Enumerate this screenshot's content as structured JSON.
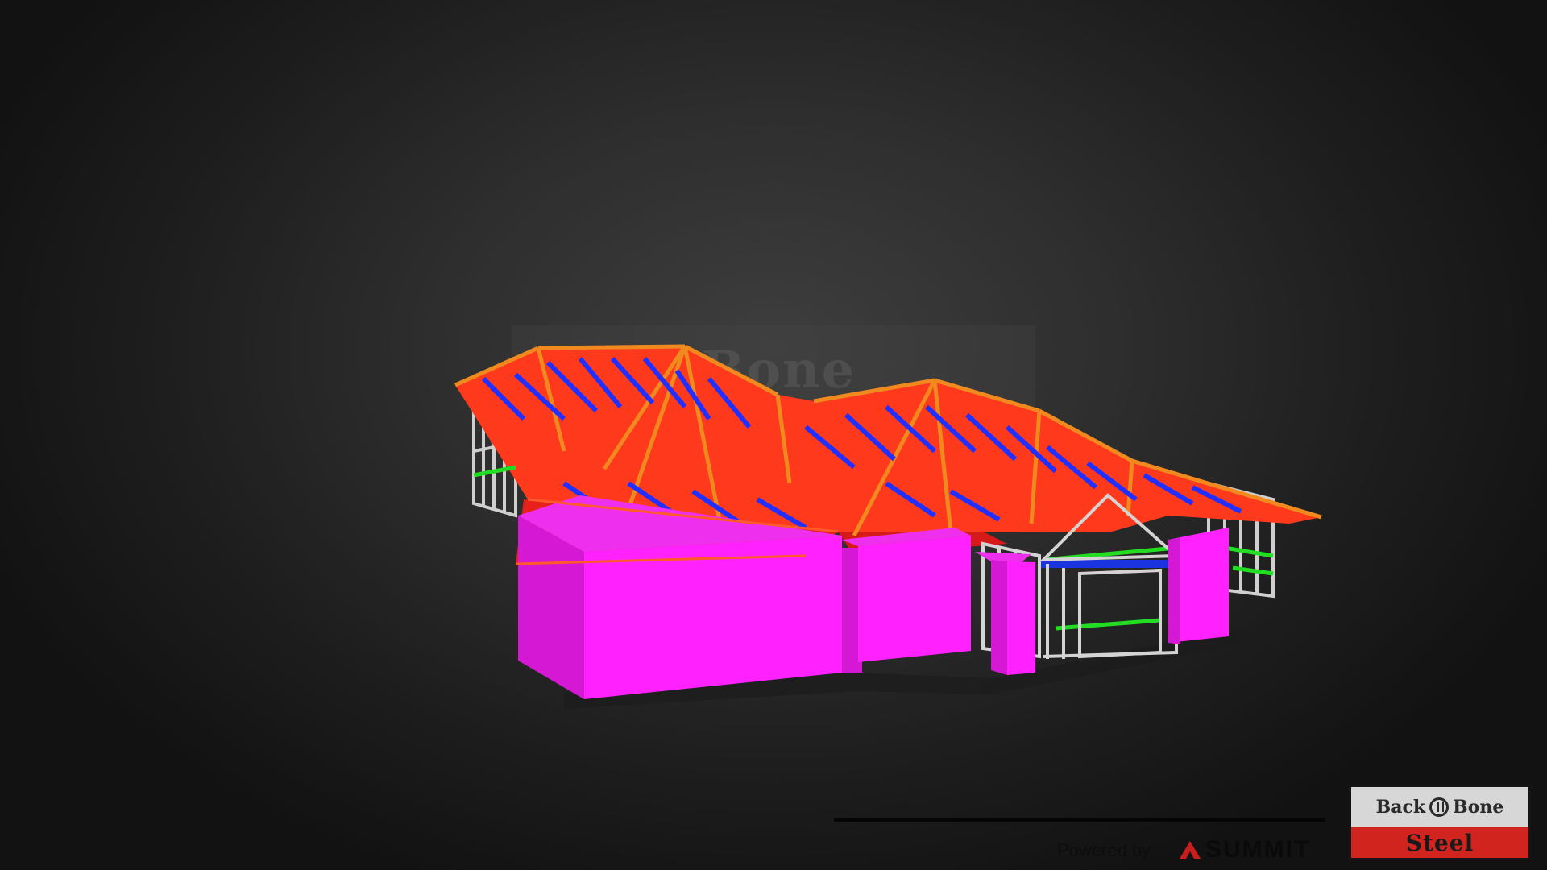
{
  "viewer": {
    "watermark_text": "Back Bone",
    "powered_by_text": "Powered by",
    "powered_by_brand": "SUMMIT",
    "powered_icon": "summit-mountain-icon"
  },
  "logo": {
    "line1_left": "Back",
    "line1_right": "Bone",
    "line2": "Steel",
    "mark_icon": "backbone-circle-icon"
  },
  "colors": {
    "wall_panels": "#ff22ff",
    "top_chords": "#ff3018",
    "webs": "#2230ff",
    "rafters": "#f08a1e",
    "noggings": "#22dd22",
    "wall_frames": "#d0d0d0",
    "logo_band": "#d1241f",
    "background": "#2e2e2e"
  }
}
